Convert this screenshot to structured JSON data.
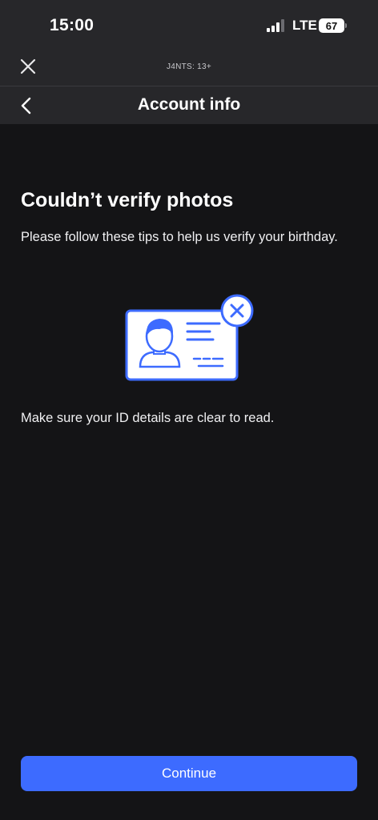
{
  "status_bar": {
    "time": "15:00",
    "network": "LTE",
    "battery": "67"
  },
  "web_bar": {
    "title": "J4NTS: 13+"
  },
  "nav": {
    "title": "Account info"
  },
  "main": {
    "heading": "Couldn’t verify photos",
    "subtext": "Please follow these tips to help us verify your birthday.",
    "tip": "Make sure your ID details are clear to read."
  },
  "footer": {
    "continue_label": "Continue"
  },
  "colors": {
    "accent": "#3d6bff",
    "background": "#141416",
    "header": "#27272a"
  },
  "icons": {
    "close": "close-icon",
    "back": "chevron-left-icon",
    "illustration": "id-card-error-icon"
  }
}
